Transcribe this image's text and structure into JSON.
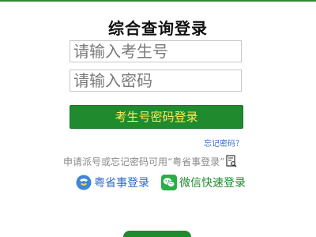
{
  "header": {
    "title": "综合查询登录"
  },
  "form": {
    "id_placeholder": "请输入考生号",
    "password_placeholder": "请输入密码",
    "login_button": "考生号密码登录",
    "forgot_link": "忘记密码？"
  },
  "note": {
    "text": "申请派号或忘记密码可用“粤省事登录”"
  },
  "alt_logins": {
    "yueshengshi": "粤省事登录",
    "wechat": "微信快速登录"
  },
  "colors": {
    "accent_green": "#1f8a2e",
    "button_text": "#ffee55",
    "link_blue": "#3a6fc4"
  },
  "icons": [
    "doc-search-icon",
    "yueshengshi-icon",
    "wechat-icon"
  ]
}
